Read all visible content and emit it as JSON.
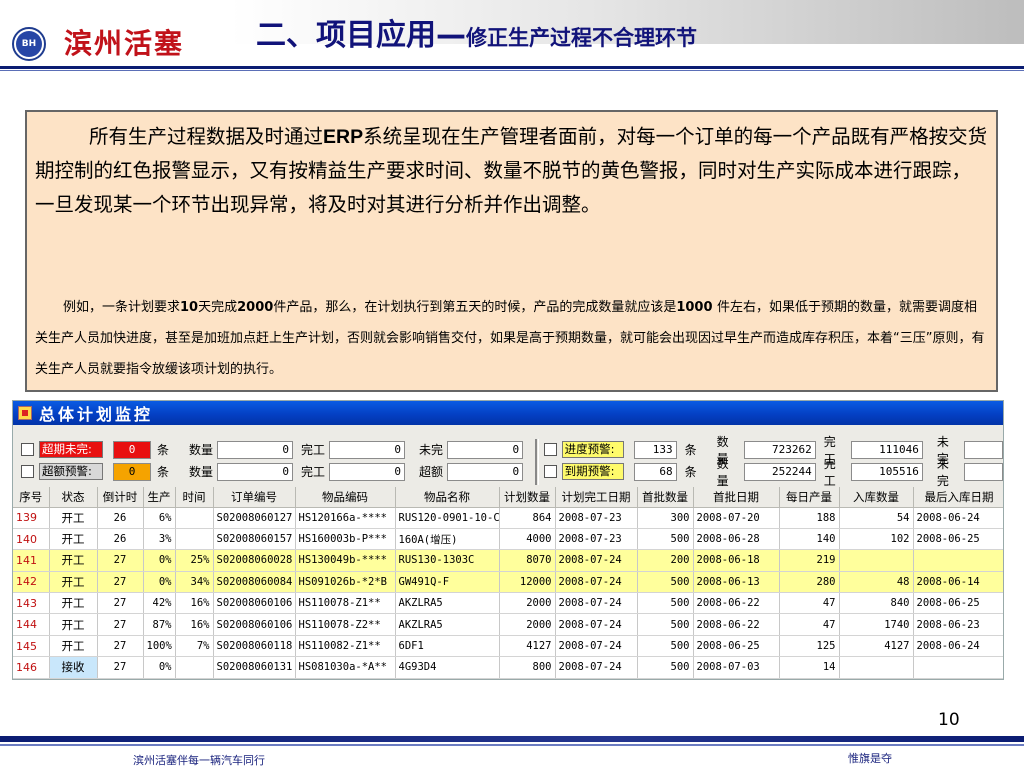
{
  "header": {
    "brand": "滨州活塞",
    "logo_text": "BH",
    "title_main": "二、项目应用—",
    "title_sub": "修正生产过程不合理环节"
  },
  "text_box": {
    "para1_pre": "所有生产过程数据及时通过",
    "para1_erp": "ERP",
    "para1_post": "系统呈现在生产管理者面前，对每一个订单的每一个产品既有严格按交货期控制的红色报警显示，又有按精益生产要求时间、数量不脱节的黄色警报，同时对生产实际成本进行跟踪，一旦发现某一个环节出现异常，将及时对其进行分析并作出调整。",
    "para2_a": "例如，一条计划要求",
    "para2_b": "10",
    "para2_c": "天完成",
    "para2_d": "2000",
    "para2_e": "件产品，那么，在计划执行到第五天的时候，产品的完成数量就应该是",
    "para2_f": "1000 ",
    "para2_g": "件左右，如果低于预期的数量，就需要调度相关生产人员加快进度，甚至是加班加点赶上生产计划，否则就会影响销售交付，如果是高于预期数量，就可能会出现因过早生产而造成库存积压，本着“三压”原则，有关生产人员就要指令放缓该项计划的执行。"
  },
  "app": {
    "title": "总体计划监控",
    "filters_left": [
      {
        "tag": "超期未完:",
        "tag_color": "red",
        "count": "0",
        "unit": "条",
        "qty_label": "数量",
        "qty": "0",
        "done_label": "完工",
        "done": "0",
        "undone_label": "未完",
        "undone": "0"
      },
      {
        "tag": "超额预警:",
        "tag_color": "grey",
        "count": "0",
        "unit": "条",
        "qty_label": "数量",
        "qty": "0",
        "done_label": "完工",
        "done": "0",
        "undone_label": "超额",
        "undone": "0"
      }
    ],
    "filters_right": [
      {
        "tag": "进度预警:",
        "count": "133",
        "unit": "条",
        "qty_label": "数量",
        "qty": "723262",
        "done_label": "完工",
        "done": "111046",
        "undone_label": "未完"
      },
      {
        "tag": "到期预警:",
        "count": "68",
        "unit": "条",
        "qty_label": "数量",
        "qty": "252244",
        "done_label": "完工",
        "done": "105516",
        "undone_label": "未完"
      }
    ],
    "columns": [
      "序号",
      "状态",
      "倒计时",
      "生产",
      "时间",
      "订单编号",
      "物品编码",
      "物品名称",
      "计划数量",
      "计划完工日期",
      "首批数量",
      "首批日期",
      "每日产量",
      "入库数量",
      "最后入库日期"
    ],
    "rows": [
      {
        "seq": "139",
        "status": "开工",
        "countdown": "26",
        "prod": "6%",
        "time": "",
        "order": "S02008060127",
        "code": "HS120166a-****",
        "name": "RUS120-0901-10-C",
        "plan_qty": "864",
        "plan_date": "2008-07-23",
        "first_qty": "300",
        "first_date": "2008-07-20",
        "daily": "188",
        "stock_qty": "54",
        "last_date": "2008-06-24",
        "highlight": false
      },
      {
        "seq": "140",
        "status": "开工",
        "countdown": "26",
        "prod": "3%",
        "time": "",
        "order": "S02008060157",
        "code": "HS160003b-P***",
        "name": "160A(增压)",
        "plan_qty": "4000",
        "plan_date": "2008-07-23",
        "first_qty": "500",
        "first_date": "2008-06-28",
        "daily": "140",
        "stock_qty": "102",
        "last_date": "2008-06-25",
        "highlight": false
      },
      {
        "seq": "141",
        "status": "开工",
        "countdown": "27",
        "prod": "0%",
        "time": "25%",
        "order": "S02008060028",
        "code": "HS130049b-****",
        "name": "RUS130-1303C",
        "plan_qty": "8070",
        "plan_date": "2008-07-24",
        "first_qty": "200",
        "first_date": "2008-06-18",
        "daily": "219",
        "stock_qty": "",
        "last_date": "",
        "highlight": true
      },
      {
        "seq": "142",
        "status": "开工",
        "countdown": "27",
        "prod": "0%",
        "time": "34%",
        "order": "S02008060084",
        "code": "HS091026b-*2*B",
        "name": "GW491Q-F",
        "plan_qty": "12000",
        "plan_date": "2008-07-24",
        "first_qty": "500",
        "first_date": "2008-06-13",
        "daily": "280",
        "stock_qty": "48",
        "last_date": "2008-06-14",
        "highlight": true
      },
      {
        "seq": "143",
        "status": "开工",
        "countdown": "27",
        "prod": "42%",
        "time": "16%",
        "order": "S02008060106",
        "code": "HS110078-Z1**",
        "name": "AKZLRA5",
        "plan_qty": "2000",
        "plan_date": "2008-07-24",
        "first_qty": "500",
        "first_date": "2008-06-22",
        "daily": "47",
        "stock_qty": "840",
        "last_date": "2008-06-25",
        "highlight": false
      },
      {
        "seq": "144",
        "status": "开工",
        "countdown": "27",
        "prod": "87%",
        "time": "16%",
        "order": "S02008060106",
        "code": "HS110078-Z2**",
        "name": "AKZLRA5",
        "plan_qty": "2000",
        "plan_date": "2008-07-24",
        "first_qty": "500",
        "first_date": "2008-06-22",
        "daily": "47",
        "stock_qty": "1740",
        "last_date": "2008-06-23",
        "highlight": false
      },
      {
        "seq": "145",
        "status": "开工",
        "countdown": "27",
        "prod": "100%",
        "time": "7%",
        "order": "S02008060118",
        "code": "HS110082-Z1**",
        "name": "6DF1",
        "plan_qty": "4127",
        "plan_date": "2008-07-24",
        "first_qty": "500",
        "first_date": "2008-06-25",
        "daily": "125",
        "stock_qty": "4127",
        "last_date": "2008-06-24",
        "highlight": false
      },
      {
        "seq": "146",
        "status": "接收",
        "countdown": "27",
        "prod": "0%",
        "time": "",
        "order": "S02008060131",
        "code": "HS081030a-*A**",
        "name": "4G93D4",
        "plan_qty": "800",
        "plan_date": "2008-07-24",
        "first_qty": "500",
        "first_date": "2008-07-03",
        "daily": "14",
        "stock_qty": "",
        "last_date": "",
        "highlight": false
      }
    ]
  },
  "footer": {
    "page_number": "10",
    "slogan": "滨州活塞伴每一辆汽车同行",
    "motto": "惟旗是夺"
  },
  "colors": {
    "title_navy": "#11137a",
    "brand_red": "#c1121a",
    "box_fill": "#fde3c6",
    "alarm_red": "#e81010",
    "alarm_yellow": "#ffff9c",
    "window_blue": "#0440c4"
  }
}
